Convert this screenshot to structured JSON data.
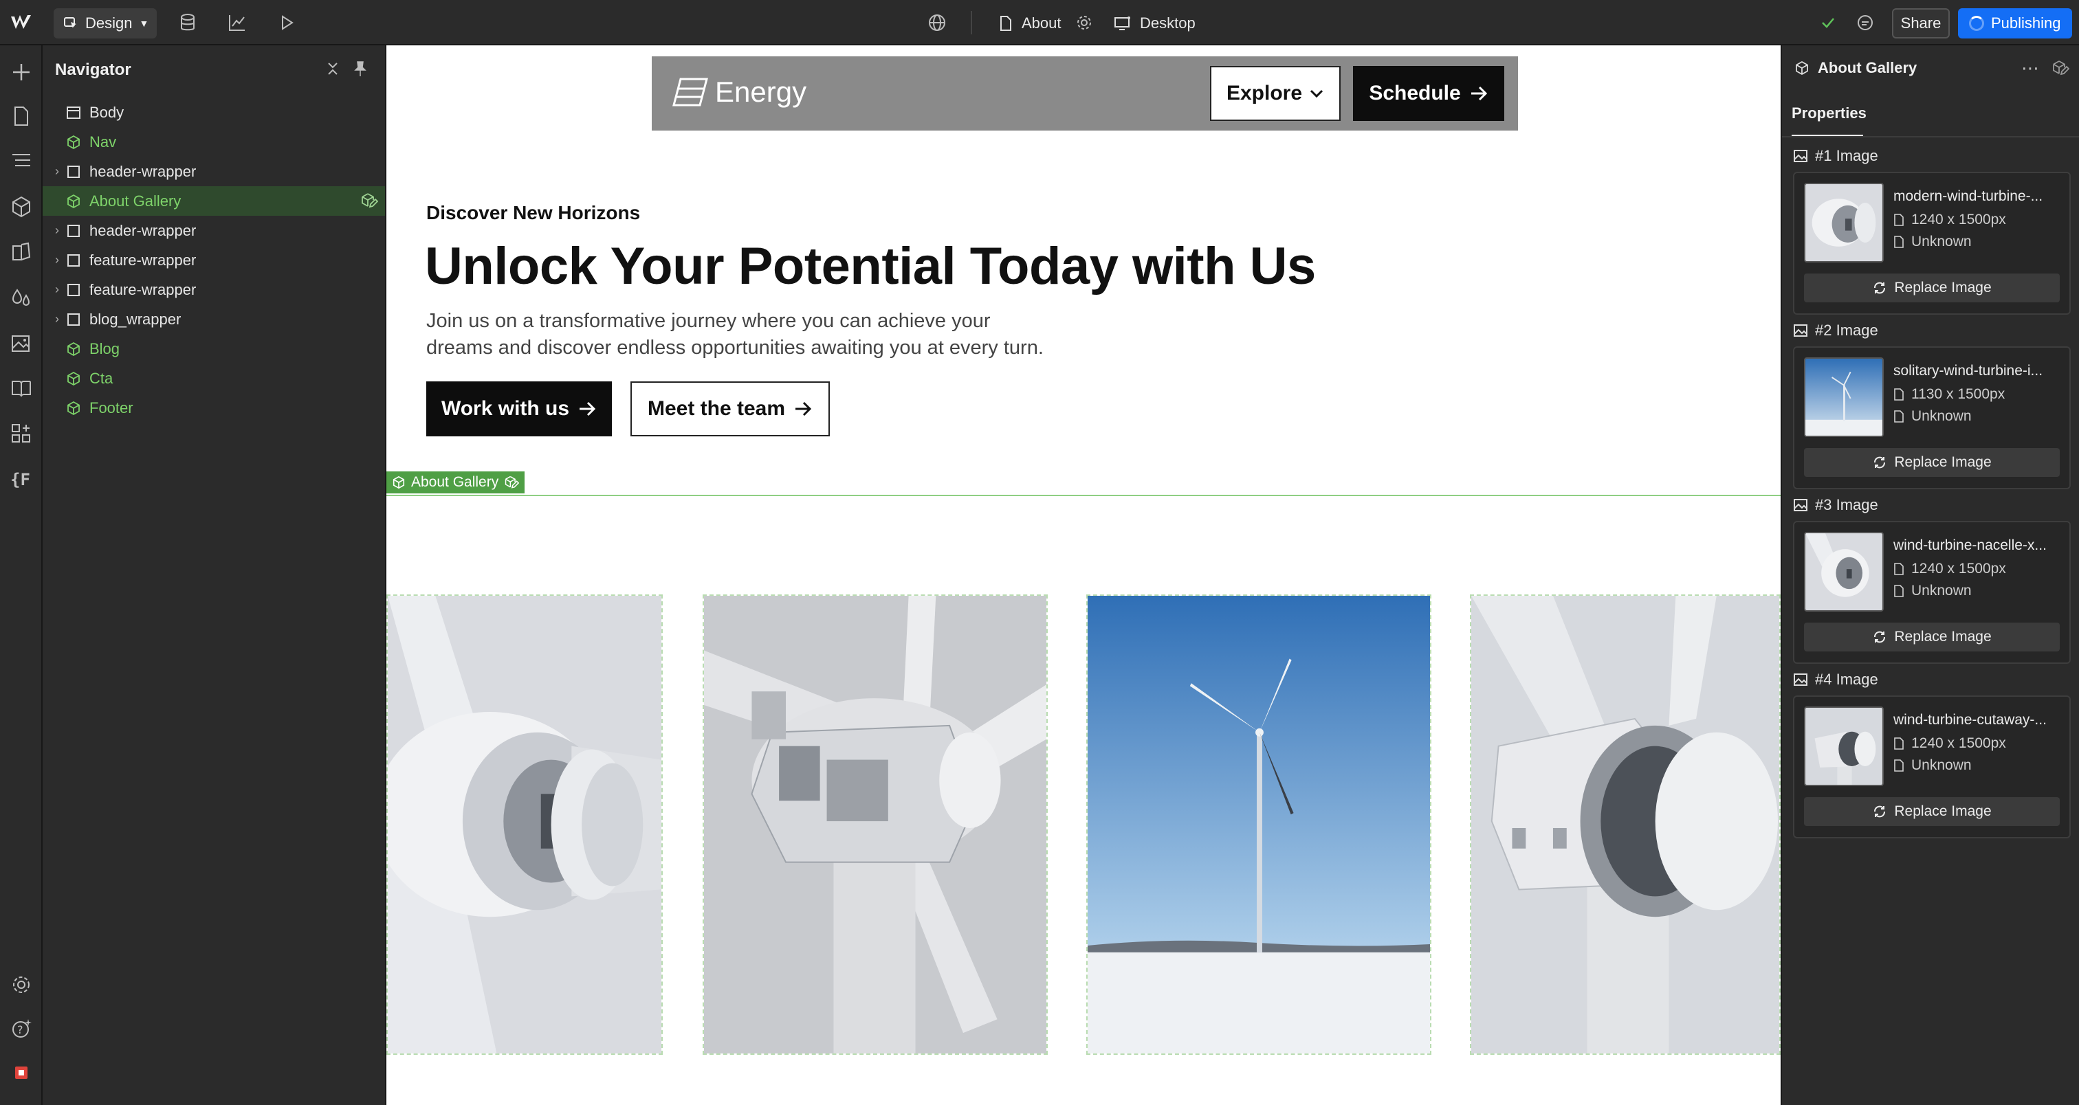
{
  "topbar": {
    "mode_label": "Design",
    "page_label": "About",
    "breakpoint_label": "Desktop",
    "share_label": "Share",
    "publish_label": "Publishing"
  },
  "navigator": {
    "title": "Navigator",
    "items": [
      {
        "label": "Body",
        "kind": "body"
      },
      {
        "label": "Nav",
        "kind": "component"
      },
      {
        "label": "header-wrapper",
        "kind": "element"
      },
      {
        "label": "About Gallery",
        "kind": "component",
        "selected": true
      },
      {
        "label": "header-wrapper",
        "kind": "element"
      },
      {
        "label": "feature-wrapper",
        "kind": "element"
      },
      {
        "label": "feature-wrapper",
        "kind": "element"
      },
      {
        "label": "blog_wrapper",
        "kind": "element"
      },
      {
        "label": "Blog",
        "kind": "component"
      },
      {
        "label": "Cta",
        "kind": "component"
      },
      {
        "label": "Footer",
        "kind": "component"
      }
    ]
  },
  "canvas": {
    "site_nav": {
      "brand": "Energy",
      "explore_label": "Explore",
      "schedule_label": "Schedule"
    },
    "hero": {
      "eyebrow": "Discover New Horizons",
      "title": "Unlock Your Potential Today with Us",
      "subtitle": "Join us on a transformative journey where you can achieve your dreams and discover endless opportunities awaiting you at every turn.",
      "primary_cta": "Work with us",
      "secondary_cta": "Meet the team"
    },
    "selection_tag": "About Gallery"
  },
  "right_panel": {
    "component_name": "About Gallery",
    "tab": "Properties",
    "replace_label": "Replace Image",
    "images": [
      {
        "label": "#1 Image",
        "filename": "modern-wind-turbine-...",
        "dimensions": "1240 x 1500px",
        "size": "Unknown"
      },
      {
        "label": "#2 Image",
        "filename": "solitary-wind-turbine-i...",
        "dimensions": "1130 x 1500px",
        "size": "Unknown"
      },
      {
        "label": "#3 Image",
        "filename": "wind-turbine-nacelle-x...",
        "dimensions": "1240 x 1500px",
        "size": "Unknown"
      },
      {
        "label": "#4 Image",
        "filename": "wind-turbine-cutaway-...",
        "dimensions": "1240 x 1500px",
        "size": "Unknown"
      }
    ]
  },
  "colors": {
    "publish_blue": "#146ef5",
    "component_green": "#7ed36a",
    "selection_green": "#4f9f45"
  }
}
